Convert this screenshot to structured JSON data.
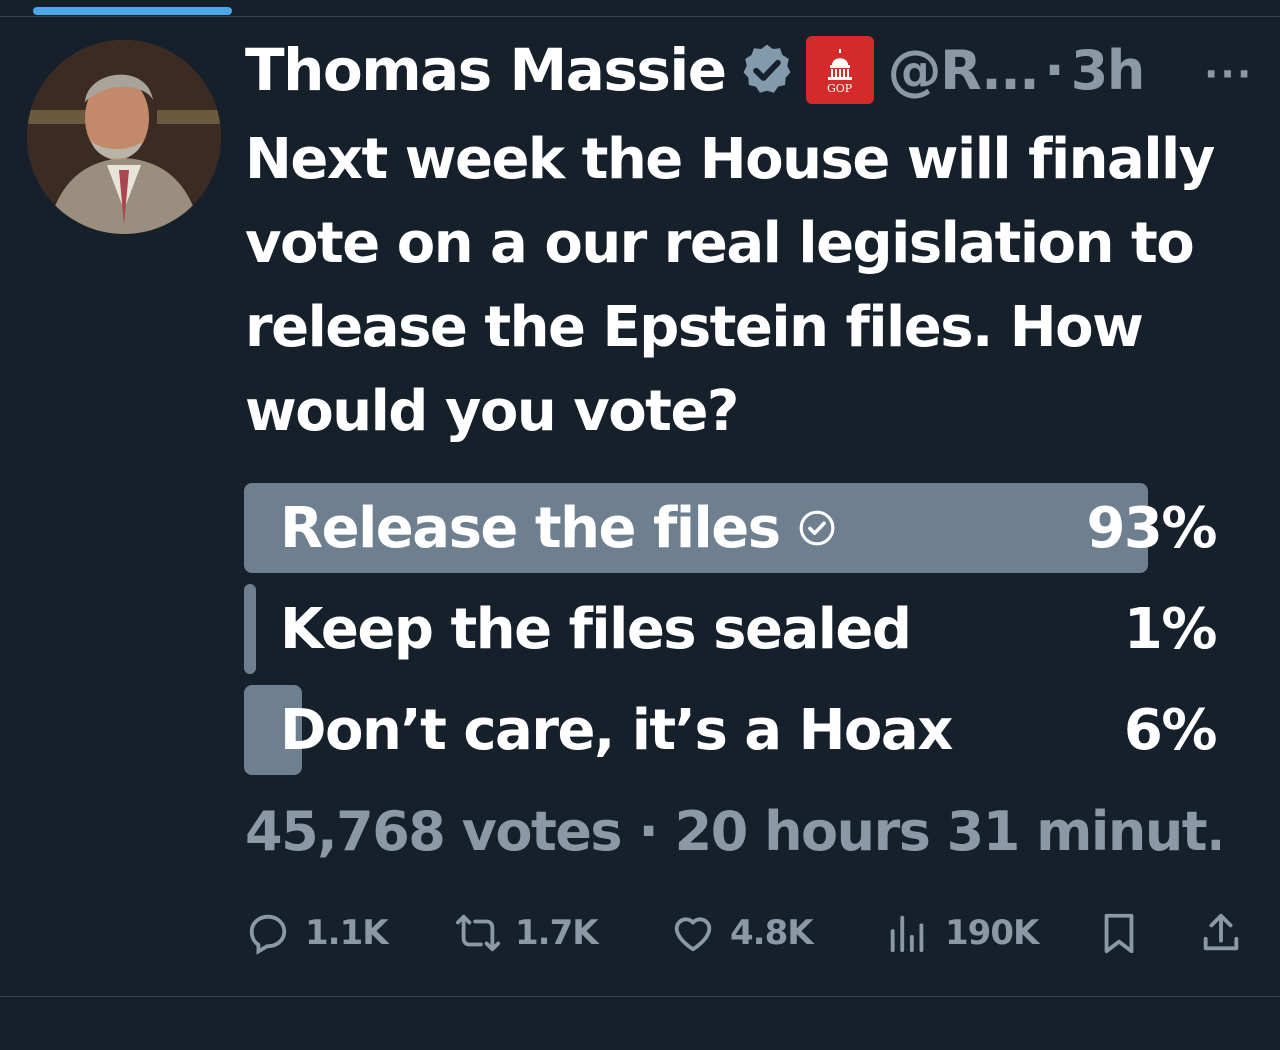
{
  "tweet": {
    "author_name": "Thomas Massie",
    "handle": "@R...",
    "separator": "·",
    "time": "3h",
    "more_label": "···",
    "org_badge_text": "GOP",
    "text": "Next week the House will finally vote on a our real legislation to release the Epstein files. How would you vote?",
    "icons": [
      "verified-badge-icon",
      "house-gop-badge-icon",
      "more-options-icon"
    ]
  },
  "poll": {
    "options": [
      {
        "label": "Release the files",
        "percent_label": "93%",
        "percent": 93,
        "selected": true
      },
      {
        "label": "Keep the files sealed",
        "percent_label": "1%",
        "percent": 1,
        "selected": false
      },
      {
        "label": "Don’t care, it’s a Hoax",
        "percent_label": "6%",
        "percent": 6,
        "selected": false
      }
    ],
    "meta": "45,768 votes · 20 hours 31 minut..."
  },
  "actions": {
    "replies": {
      "count": "1.1K",
      "icon": "reply-icon"
    },
    "reposts": {
      "count": "1.7K",
      "icon": "repost-icon"
    },
    "likes": {
      "count": "4.8K",
      "icon": "heart-icon"
    },
    "views": {
      "count": "190K",
      "icon": "views-icon"
    },
    "bookmark": {
      "icon": "bookmark-icon"
    },
    "share": {
      "icon": "share-icon"
    }
  },
  "colors": {
    "background": "#15202b",
    "text": "#ffffff",
    "secondary_text": "#8b98a5",
    "poll_bar": "#6e7f90",
    "verified": "#829aab",
    "org_badge": "#d42a2a",
    "accent": "#4aa8e8"
  }
}
